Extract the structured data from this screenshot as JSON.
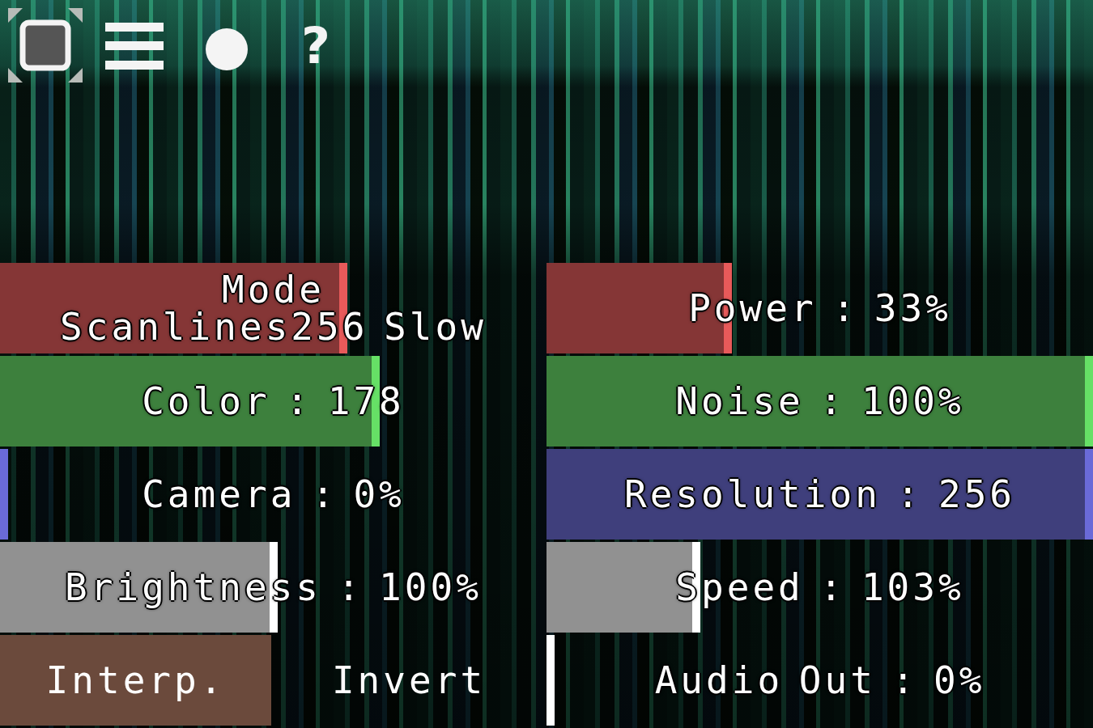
{
  "toolbar": [
    {
      "kind": "fullscreen"
    },
    {
      "kind": "menu"
    },
    {
      "kind": "record"
    },
    {
      "kind": "help",
      "text": "?"
    }
  ],
  "controls": [
    {
      "kind": "select",
      "label": "Mode",
      "value": "Scanlines256 Slow",
      "level": 0.63,
      "color": "#e85a5a"
    },
    {
      "kind": "slider",
      "text": "Power : 33%",
      "level": 0.33,
      "color": "#e85a5a"
    },
    {
      "kind": "slider",
      "text": "Color : 178",
      "level": 0.69,
      "color": "#66e066"
    },
    {
      "kind": "slider",
      "text": "Noise : 100%",
      "level": 1,
      "color": "#66e066"
    },
    {
      "kind": "slider",
      "text": "Camera : 0%",
      "level": 0,
      "color": "#6a6ad8"
    },
    {
      "kind": "slider",
      "text": "Resolution : 256",
      "level": 1,
      "color": "#6a6ad8"
    },
    {
      "kind": "slider",
      "text": "Brightness : 100%",
      "level": 0.5,
      "color": "#ffffff"
    },
    {
      "kind": "slider",
      "text": "Speed : 103%",
      "level": 0.27,
      "color": "#ffffff"
    },
    {
      "kind": "toggles",
      "items": [
        {
          "label": "Interp.",
          "on": true
        },
        {
          "label": "Invert",
          "on": false
        }
      ]
    },
    {
      "kind": "slider",
      "text": "Audio Out : 0%",
      "level": 0,
      "color": "#ffffff"
    }
  ]
}
